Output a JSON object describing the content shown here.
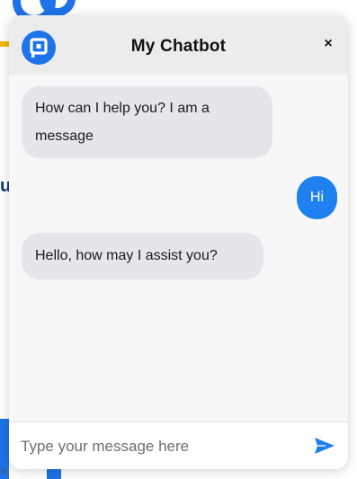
{
  "header": {
    "title": "My Chatbot",
    "close_label": "×"
  },
  "messages": [
    {
      "sender": "bot",
      "text": "How can I help you? I am a message"
    },
    {
      "sender": "user",
      "text": "Hi"
    },
    {
      "sender": "bot",
      "text": "Hello, how may I assist you?"
    }
  ],
  "composer": {
    "placeholder": "Type your message here",
    "value": ""
  },
  "background": {
    "partial_letter": "u",
    "partial_close": "×"
  },
  "colors": {
    "accent": "#1f80f0",
    "bot_bubble": "#e5e5ea",
    "header_bg": "#ececed",
    "body_bg": "#f7f7f8"
  },
  "icons": {
    "logo": "chatbot-logo-icon",
    "close": "close-icon",
    "send": "send-icon"
  }
}
